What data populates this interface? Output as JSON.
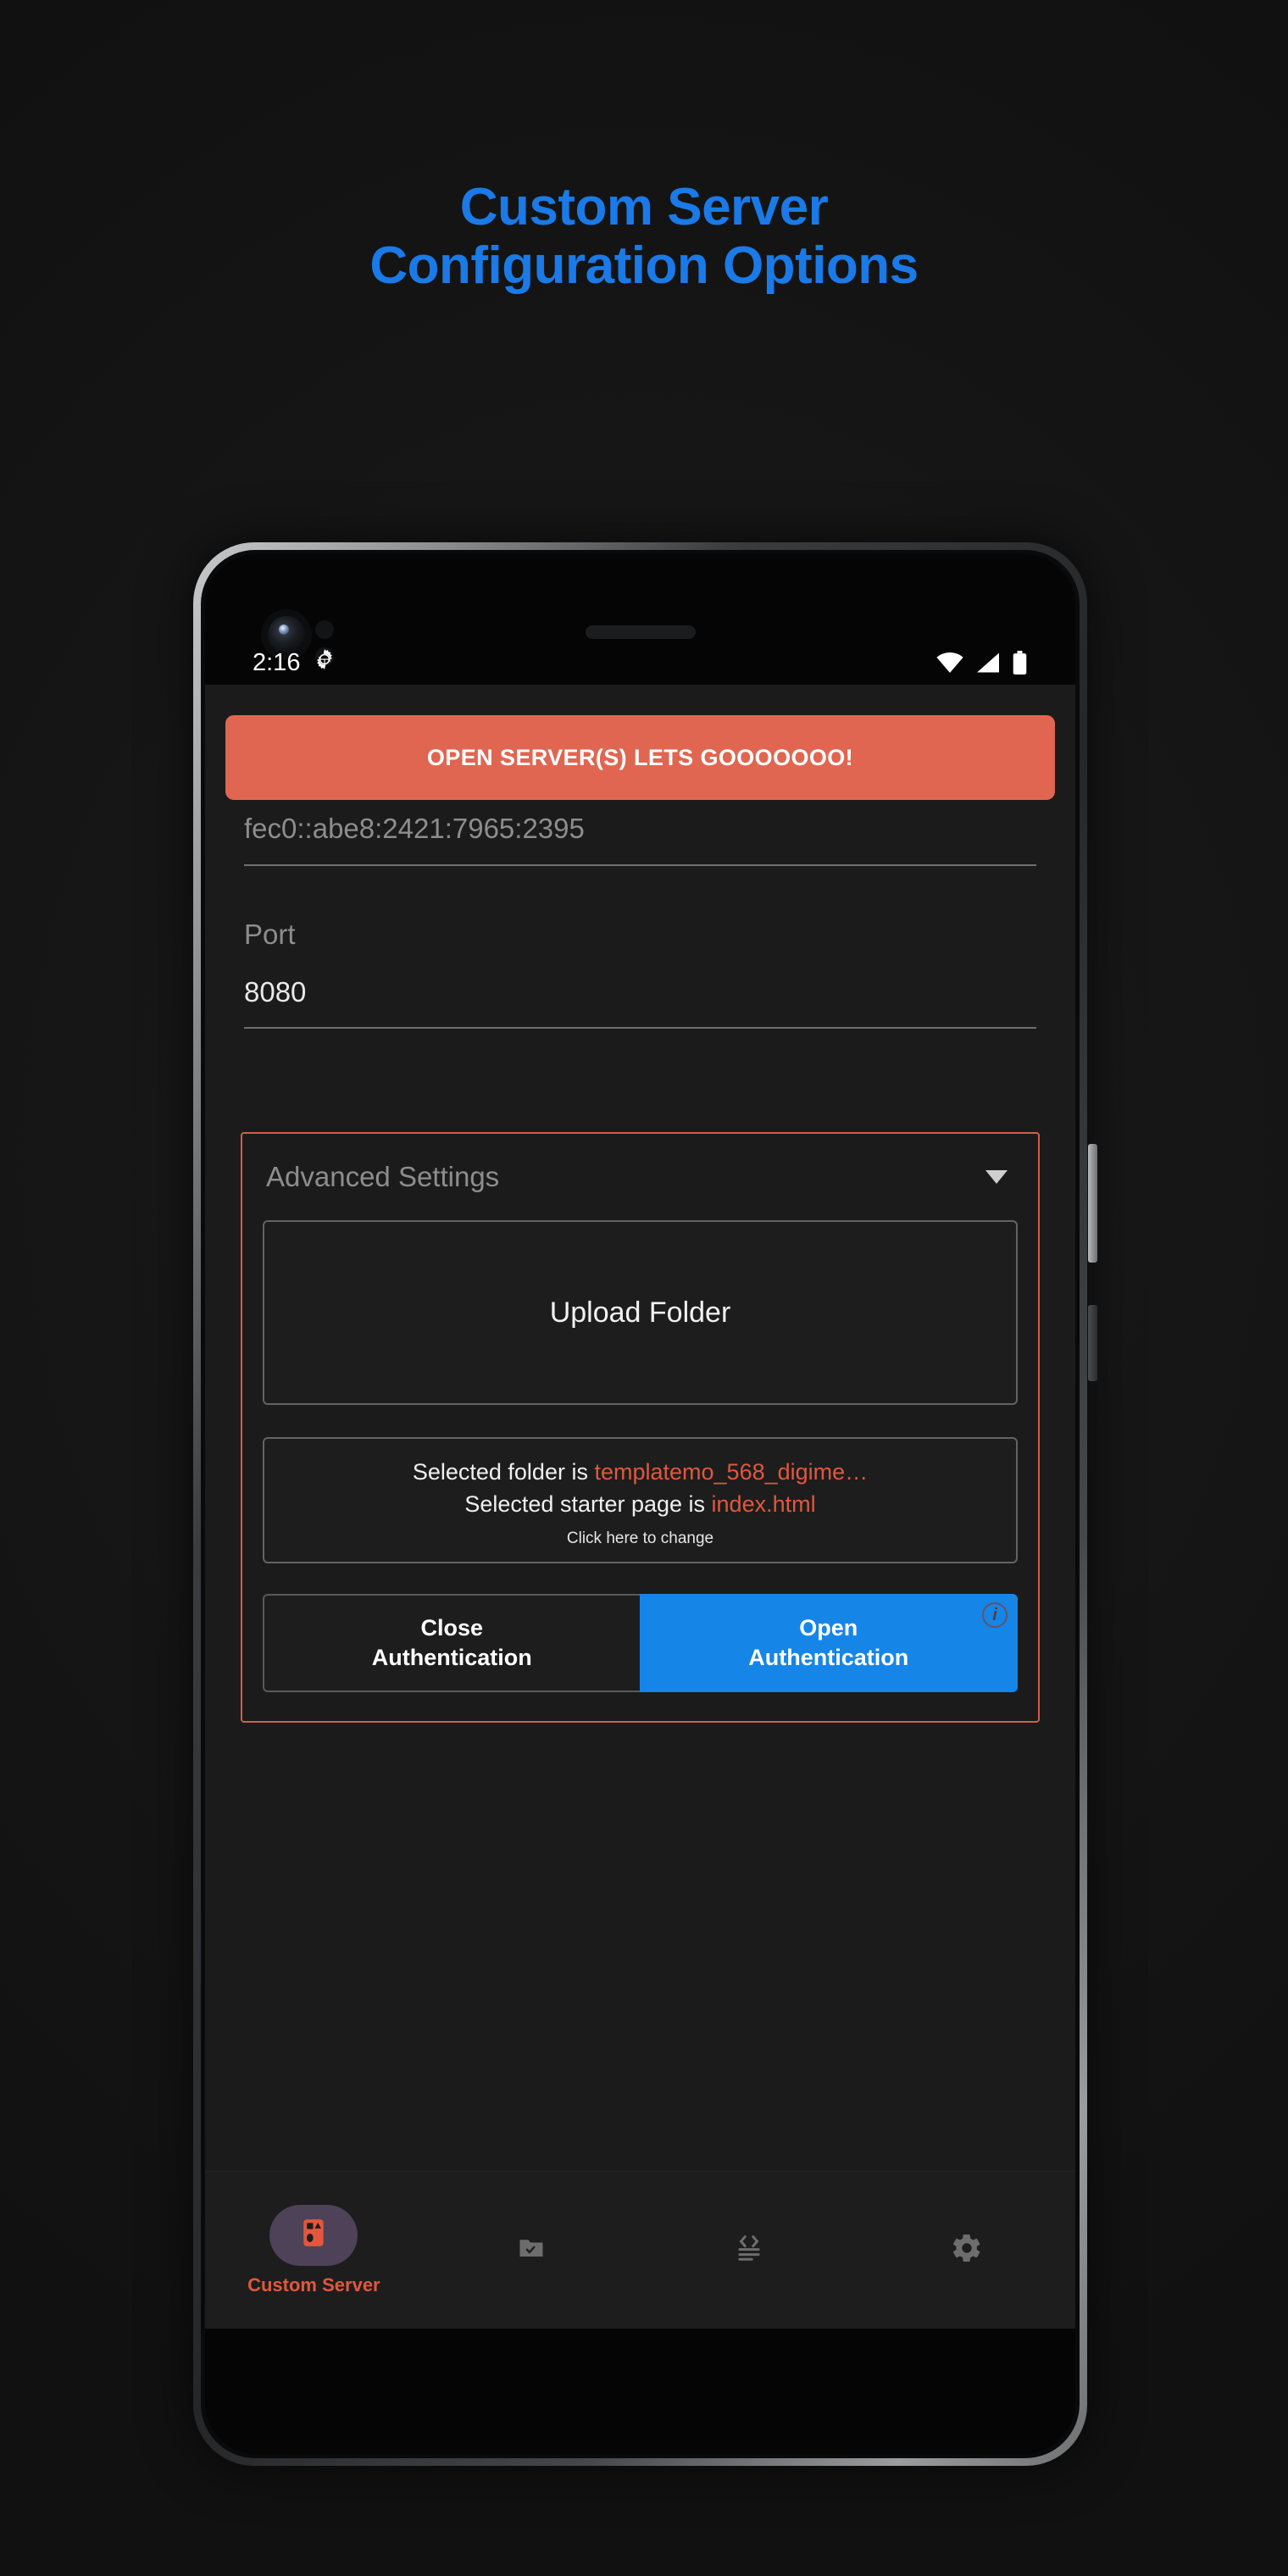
{
  "headline": {
    "line1": "Custom Server",
    "line2": "Configuration Options",
    "color": "#1a7ae8"
  },
  "statusbar": {
    "time": "2:16",
    "gear_icon": "gear-icon",
    "wifi_icon": "wifi-icon",
    "signal_icon": "signal-icon",
    "battery_icon": "battery-icon"
  },
  "app": {
    "cta_label": "OPEN SERVER(S) LETS GOOOOOOO!",
    "cta_color": "#e06651",
    "fields": {
      "ip": {
        "value": "fec0::abe8:2421:7965:2395"
      },
      "port": {
        "label": "Port",
        "value": "8080"
      }
    },
    "advanced": {
      "title": "Advanced Settings",
      "caret_icon": "chevron-down-icon",
      "border_color": "#d25f47",
      "upload_label": "Upload Folder",
      "info": {
        "folder_prefix": "Selected folder is ",
        "folder_name": "templatemo_568_digime…",
        "starter_prefix": "Selected starter page is ",
        "starter_name": "index.html",
        "hint": "Click here to change",
        "highlight_color": "#e2573d"
      },
      "buttons": {
        "close_line1": "Close",
        "close_line2": "Authentication",
        "open_line1": "Open",
        "open_line2": "Authentication",
        "open_color": "#1685e8",
        "info_icon": "info-icon",
        "info_glyph": "i"
      }
    },
    "bottom_nav": [
      {
        "label": "Custom Server",
        "icon": "shapes-icon",
        "active": true
      },
      {
        "label": "",
        "icon": "folder-check-icon",
        "active": false
      },
      {
        "label": "",
        "icon": "code-lines-icon",
        "active": false
      },
      {
        "label": "",
        "icon": "gear-icon",
        "active": false
      }
    ]
  }
}
